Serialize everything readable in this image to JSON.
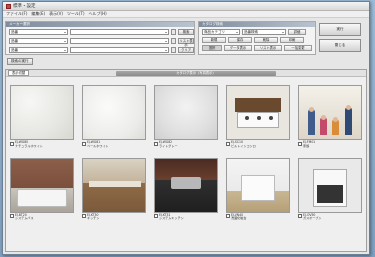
{
  "window": {
    "title": "標準・設定"
  },
  "menu": [
    "ファイル(F)",
    "編集(E)",
    "表示(V)",
    "ツール(T)",
    "ヘルプ(H)"
  ],
  "filters_left": {
    "header": "メーカー選択",
    "rows": [
      {
        "a": "品番",
        "b": "",
        "btn": "検索"
      },
      {
        "a": "品番",
        "b": "",
        "btn": "リスト表示"
      },
      {
        "a": "品番",
        "b": "",
        "btn": "クリア"
      }
    ]
  },
  "filters_right": {
    "header": "カタログ検索",
    "row1": [
      "商品カテゴリ",
      "品番検索",
      "詳細"
    ],
    "row2": [
      "新規",
      "保存",
      "削除",
      "印刷"
    ],
    "row3": [
      "選択",
      "データ表示",
      "リスト表示",
      "一括変更"
    ]
  },
  "side_actions": [
    "実行",
    "閉じる"
  ],
  "action_strip": [
    "検索の実行"
  ],
  "results": {
    "tab": "表示切替",
    "title": "カタログ表示（写真表示）"
  },
  "cards": [
    {
      "code": "EJ-WG80",
      "name": "ナチュラルホワイト"
    },
    {
      "code": "EJ-WG81",
      "name": "ペールホワイト"
    },
    {
      "code": "EJ-WG82",
      "name": "ライトグレー"
    },
    {
      "code": "EJ-SC10",
      "name": "ビルトインコンロ"
    },
    {
      "code": "EJ-FM01",
      "name": "家族"
    },
    {
      "code": "EJ-BT20",
      "name": "システムバス"
    },
    {
      "code": "EJ-KT30",
      "name": "キッチン"
    },
    {
      "code": "EJ-KT31",
      "name": "システムキッチン"
    },
    {
      "code": "EJ-VN40",
      "name": "洗面化粧台"
    },
    {
      "code": "EJ-OV50",
      "name": "ガスオーブン"
    }
  ]
}
